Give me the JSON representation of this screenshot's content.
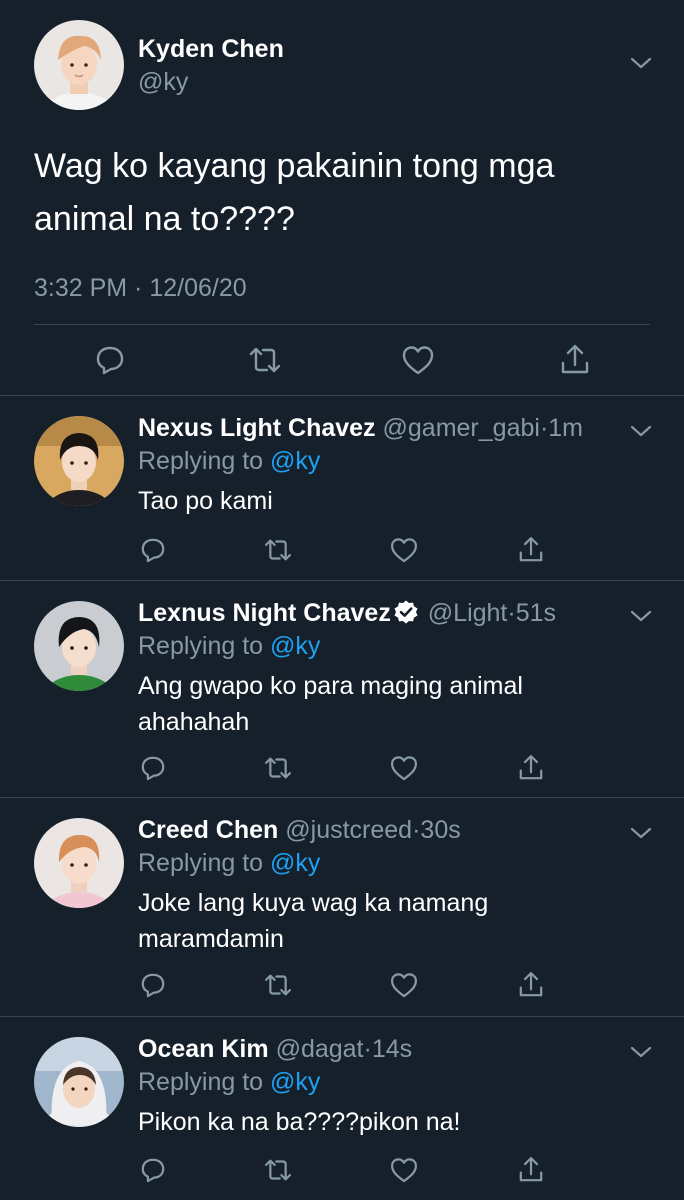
{
  "main_tweet": {
    "name": "Kyden Chen",
    "handle": "@ky",
    "text": "Wag ko kayang pakainin tong mga animal na to????",
    "timestamp": "3:32 PM · 12/06/20",
    "avatar": "avatar-photo"
  },
  "replies": [
    {
      "name": "Nexus Light Chavez",
      "handle": "@gamer_gabi",
      "time": "1m",
      "verified": false,
      "replying_label": "Replying to",
      "replying_to": "@ky",
      "text": "Tao po kami"
    },
    {
      "name": "Lexnus Night Chavez",
      "handle": "@Light",
      "time": "51s",
      "verified": true,
      "replying_label": "Replying to",
      "replying_to": "@ky",
      "text": "Ang gwapo ko para maging animal ahahahah"
    },
    {
      "name": "Creed Chen",
      "handle": "@justcreed",
      "time": "30s",
      "verified": false,
      "replying_label": "Replying to",
      "replying_to": "@ky",
      "text": "Joke lang kuya wag ka namang maramdamin"
    },
    {
      "name": "Ocean Kim",
      "handle": "@dagat",
      "time": "14s",
      "verified": false,
      "replying_label": "Replying to",
      "replying_to": "@ky",
      "text": "Pikon ka na ba????pikon na!"
    }
  ],
  "actions": [
    "reply-icon",
    "retweet-icon",
    "like-icon",
    "share-icon"
  ],
  "colors": {
    "background": "#15202b",
    "divider": "#38444d",
    "secondary_text": "#8899a6",
    "accent": "#1da1f2"
  }
}
